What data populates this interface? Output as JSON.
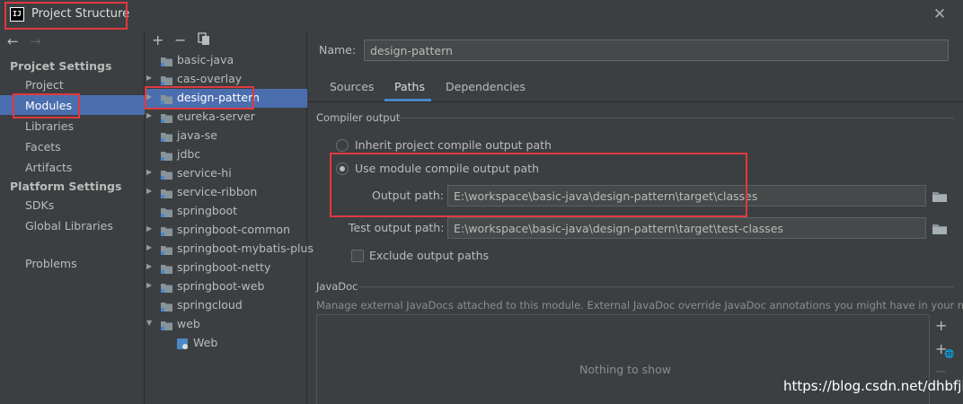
{
  "window": {
    "title": "Project Structure",
    "app_icon_text": "IJ"
  },
  "left_nav": {
    "project_settings_header": "Projcet Settings",
    "project_settings": [
      "Project",
      "Modules",
      "Libraries",
      "Facets",
      "Artifacts"
    ],
    "platform_settings_header": "Platform Settings",
    "platform_settings": [
      "SDKs",
      "Global Libraries"
    ],
    "problems": "Problems",
    "selected": "Modules"
  },
  "tree_toolbar": {
    "add": "+",
    "remove": "−"
  },
  "tree": [
    {
      "label": "basic-java",
      "expandable": false
    },
    {
      "label": "cas-overlay",
      "expandable": true
    },
    {
      "label": "design-pattern",
      "expandable": true,
      "selected": true
    },
    {
      "label": "eureka-server",
      "expandable": true
    },
    {
      "label": "java-se",
      "expandable": false
    },
    {
      "label": "jdbc",
      "expandable": false
    },
    {
      "label": "service-hi",
      "expandable": true
    },
    {
      "label": "service-ribbon",
      "expandable": true
    },
    {
      "label": "springboot",
      "expandable": false
    },
    {
      "label": "springboot-common",
      "expandable": true
    },
    {
      "label": "springboot-mybatis-plus",
      "expandable": true
    },
    {
      "label": "springboot-netty",
      "expandable": true
    },
    {
      "label": "springboot-web",
      "expandable": true
    },
    {
      "label": "springcloud",
      "expandable": false
    },
    {
      "label": "web",
      "expandable": true,
      "expanded": true
    },
    {
      "label": "Web",
      "child": true
    }
  ],
  "module": {
    "name_label": "Name:",
    "name_value": "design-pattern",
    "tabs": [
      "Sources",
      "Paths",
      "Dependencies"
    ],
    "active_tab": "Paths",
    "compiler_output_title": "Compiler output",
    "inherit_label": "Inherit project compile output path",
    "use_module_label": "Use module compile output path",
    "selected_option": "Use module compile output path",
    "output_path_label": "Output path:",
    "output_path_value": "E:\\workspace\\basic-java\\design-pattern\\target\\classes",
    "test_output_path_label": "Test output path:",
    "test_output_path_value": "E:\\workspace\\basic-java\\design-pattern\\target\\test-classes",
    "exclude_label": "Exclude output paths",
    "exclude_checked": false,
    "javadoc_title": "JavaDoc",
    "javadoc_desc": "Manage external JavaDocs attached to this module. External JavaDoc override JavaDoc annotations you might have in your module.",
    "javadoc_empty": "Nothing to show"
  },
  "watermark": "https://blog.csdn.net/dhbfjh",
  "colors": {
    "background": "#3c3f41",
    "selection": "#4b6eaf",
    "highlight_box": "#e0393e",
    "folder_icon": "#87939a",
    "tab_underline": "#4a88c7"
  }
}
